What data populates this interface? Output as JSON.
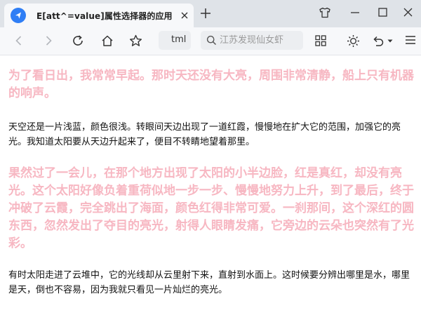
{
  "browser": {
    "tab": {
      "title": "E[att^=value]属性选择器的应用"
    },
    "address": {
      "text": "tml"
    },
    "search": {
      "placeholder": "江苏发现仙女虾"
    }
  },
  "page": {
    "paragraphs": [
      {
        "style": "pink",
        "text": "为了看日出，我常常早起。那时天还没有大亮，周围非常清静，船上只有机器的响声。"
      },
      {
        "style": "dark",
        "text": "天空还是一片浅蓝，颜色很浅。转眼间天边出现了一道红霞，慢慢地在扩大它的范围，加强它的亮光。我知道太阳要从天边升起来了，便目不转睛地望着那里。"
      },
      {
        "style": "pink",
        "text": "果然过了一会儿，在那个地方出现了太阳的小半边脸，红是真红，却没有亮光。这个太阳好像负着重荷似地一步一步、慢慢地努力上升，到了最后，终于冲破了云霞，完全跳出了海面，颜色红得非常可爱。一刹那间，这个深红的圆东西，忽然发出了夺目的亮光，射得人眼睛发痛，它旁边的云朵也突然有了光彩。"
      },
      {
        "style": "dark",
        "text": "有时太阳走进了云堆中，它的光线却从云里射下来，直射到水面上。这时候要分辨出哪里是水，哪里是天，倒也不容易，因为我就只看见一片灿烂的亮光。"
      }
    ]
  },
  "colors": {
    "pink_text": "#f7b7c2",
    "dark_text": "#111111",
    "accent": "#2f7ef5"
  }
}
